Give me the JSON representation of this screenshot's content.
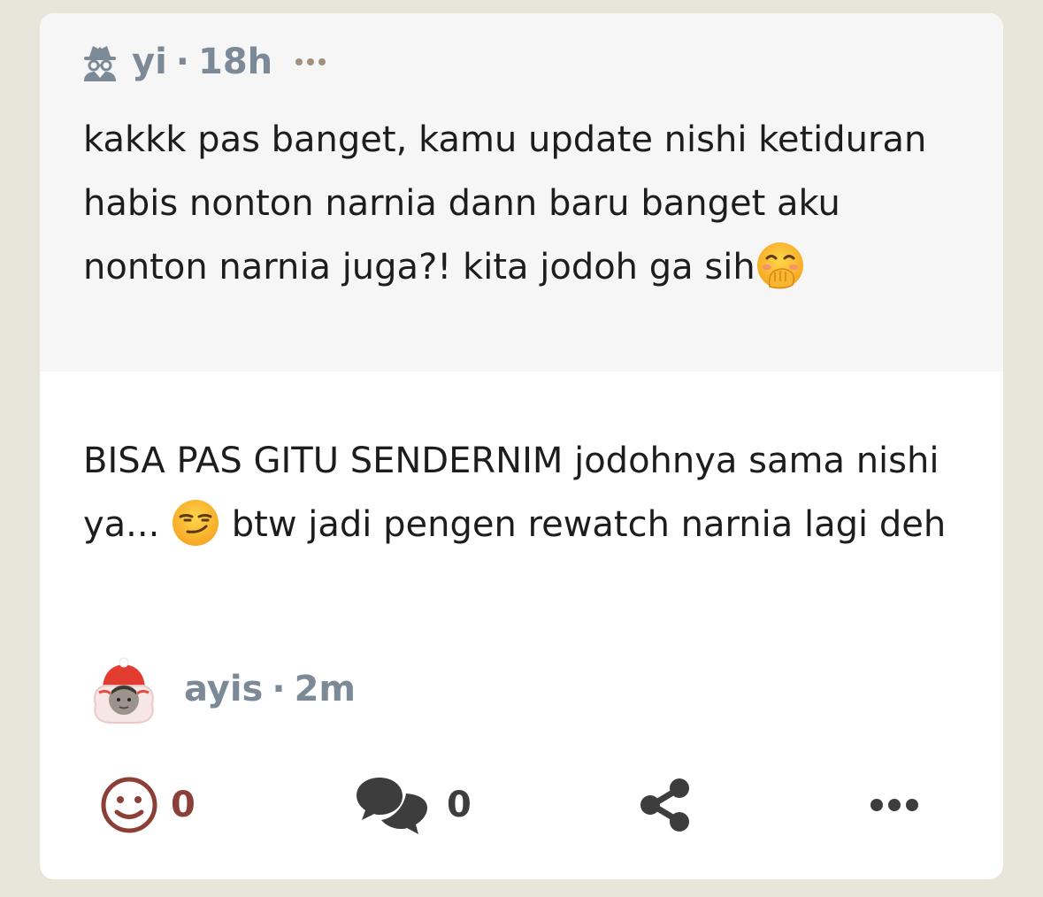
{
  "quoted_post": {
    "author": "yi",
    "separator": "·",
    "time": "18h",
    "text": "kakkk pas banget, kamu update nishi ketiduran habis nonton narnia dann baru banget aku nonton narnia juga?! kita jodoh ga sih",
    "emoji": "face-with-hand-over-mouth"
  },
  "reply": {
    "text_before": "BISA PAS GITU SENDERNIM jodohnya sama nishi ya... ",
    "emoji": "smirking-face",
    "text_after": " btw jadi pengen rewatch narnia lagi deh",
    "author": "ayis",
    "separator": "·",
    "time": "2m"
  },
  "actions": {
    "reactions_count": "0",
    "comments_count": "0"
  },
  "colors": {
    "background": "#e8e6da",
    "quote_background": "#f6f6f6",
    "muted_text": "#7b8a96",
    "reaction_accent": "#8b3f36"
  }
}
